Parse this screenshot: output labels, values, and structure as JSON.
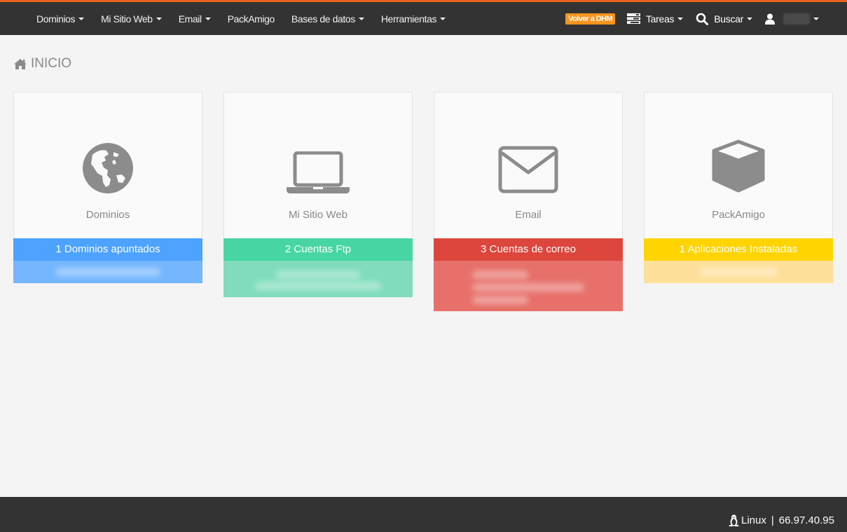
{
  "nav": {
    "items": [
      {
        "label": "Dominios",
        "dropdown": true
      },
      {
        "label": "Mi Sitio Web",
        "dropdown": true
      },
      {
        "label": "Email",
        "dropdown": true
      },
      {
        "label": "PackAmigo",
        "dropdown": false
      },
      {
        "label": "Bases de datos",
        "dropdown": true
      },
      {
        "label": "Herramientas",
        "dropdown": true
      }
    ],
    "dhm_label": "Volver a DHM",
    "tareas_label": "Tareas",
    "buscar_label": "Buscar"
  },
  "breadcrumb": {
    "label": "INICIO"
  },
  "cards": [
    {
      "label": "Dominios",
      "icon": "globe-icon",
      "bar": "1 Dominios apuntados",
      "color": "#4da3ff",
      "foot_color": "#74b6ff"
    },
    {
      "label": "Mi Sitio Web",
      "icon": "laptop-icon",
      "bar": "2 Cuentas Ftp",
      "color": "#47d6a3",
      "foot_color": "#80dcbc"
    },
    {
      "label": "Email",
      "icon": "envelope-icon",
      "bar": "3 Cuentas de correo",
      "color": "#dc463c",
      "foot_color": "#e7706a"
    },
    {
      "label": "PackAmigo",
      "icon": "cube-icon",
      "bar": "1 Aplicaciones Instaladas",
      "color": "#ffd400",
      "foot_color": "#fee09a"
    }
  ],
  "footer": {
    "os": "Linux",
    "separator": "|",
    "ip": "66.97.40.95"
  },
  "colors": {
    "navbar": "#333333",
    "accent": "#e5631c",
    "dhm_button": "#f7941d"
  }
}
